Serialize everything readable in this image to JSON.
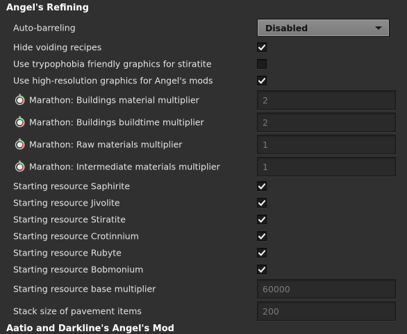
{
  "section_title": "Angel's Refining",
  "footer_title": "Aatio and Darkline's Angel's Mod",
  "settings": [
    {
      "label": "Auto-barreling",
      "type": "dropdown",
      "value": "Disabled"
    },
    {
      "label": "Hide voiding recipes",
      "type": "checkbox",
      "checked": true
    },
    {
      "label": "Use trypophobia friendly graphics for stiratite",
      "type": "checkbox",
      "checked": false
    },
    {
      "label": "Use high-resolution graphics for Angel's mods",
      "type": "checkbox",
      "checked": true
    },
    {
      "label": "Marathon: Buildings material multiplier",
      "type": "number",
      "value": "2",
      "icon": "marathon-clock-icon"
    },
    {
      "label": "Marathon: Buildings buildtime multiplier",
      "type": "number",
      "value": "2",
      "icon": "marathon-clock-icon"
    },
    {
      "label": "Marathon: Raw materials multiplier",
      "type": "number",
      "value": "1",
      "icon": "marathon-clock-icon"
    },
    {
      "label": "Marathon: Intermediate materials multiplier",
      "type": "number",
      "value": "1",
      "icon": "marathon-clock-icon"
    },
    {
      "label": "Starting resource Saphirite",
      "type": "checkbox",
      "checked": true
    },
    {
      "label": "Starting resource Jivolite",
      "type": "checkbox",
      "checked": true
    },
    {
      "label": "Starting resource Stiratite",
      "type": "checkbox",
      "checked": true
    },
    {
      "label": "Starting resource Crotinnium",
      "type": "checkbox",
      "checked": true
    },
    {
      "label": "Starting resource Rubyte",
      "type": "checkbox",
      "checked": true
    },
    {
      "label": "Starting resource Bobmonium",
      "type": "checkbox",
      "checked": true
    },
    {
      "label": "Starting resource base multiplier",
      "type": "number",
      "value": "60000"
    },
    {
      "label": "Stack size of pavement items",
      "type": "number",
      "value": "200"
    }
  ]
}
